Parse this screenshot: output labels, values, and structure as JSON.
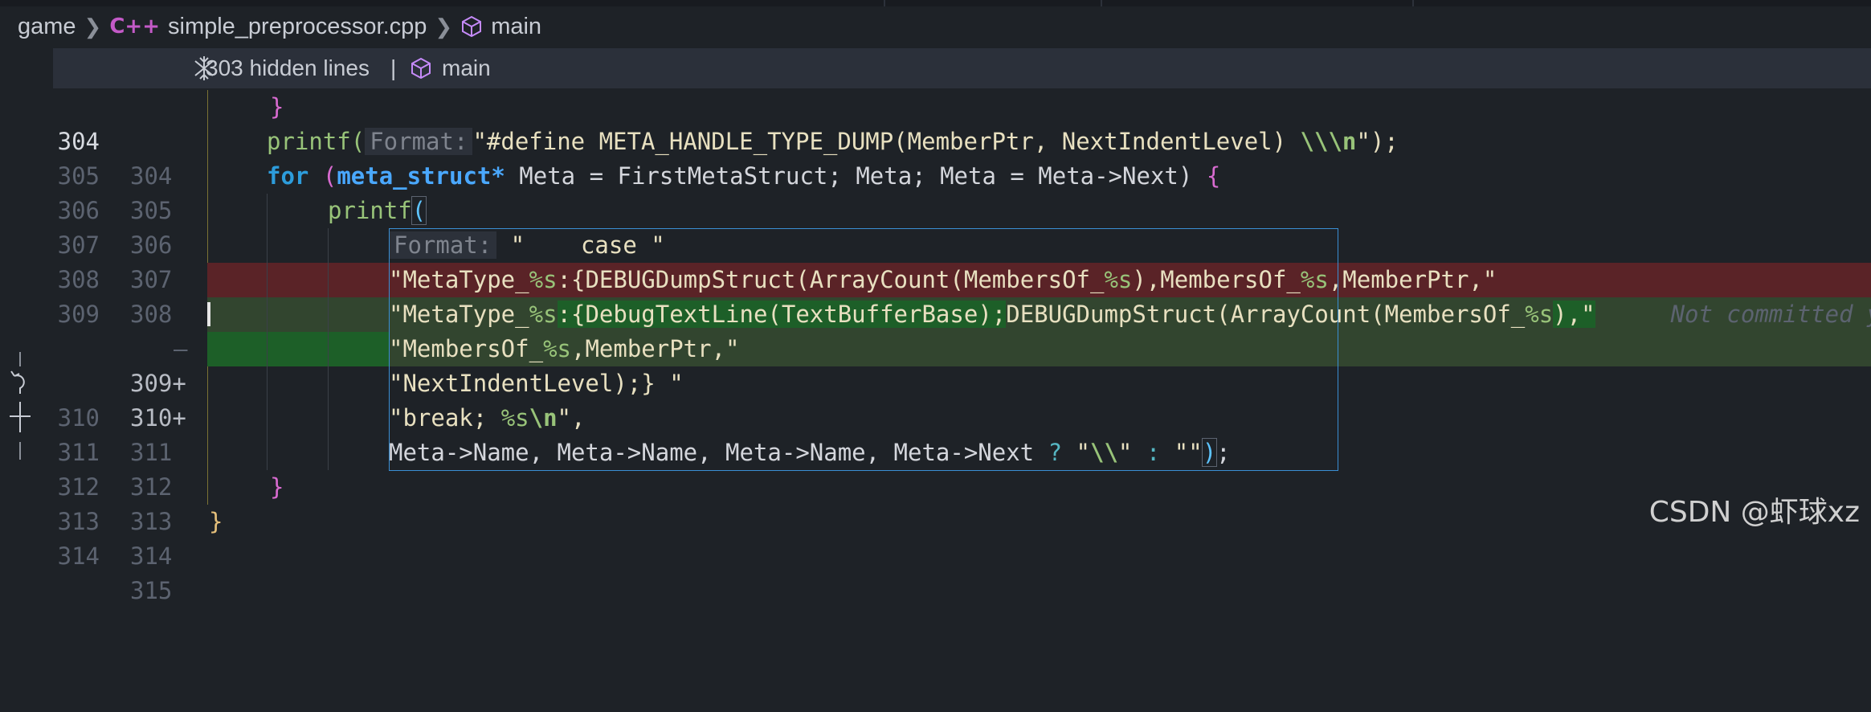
{
  "breadcrumb": {
    "folder": "game",
    "file_icon": "C++",
    "file": "simple_preprocessor.cpp",
    "symbol": "main"
  },
  "sticky": {
    "hidden_lines": "303 hidden lines",
    "pipe": "|",
    "symbol": "main"
  },
  "lines": [
    {
      "left": "304",
      "right": "304"
    },
    {
      "left": "305",
      "right": "305"
    },
    {
      "left": "306",
      "right": "306"
    },
    {
      "left": "307",
      "right": "307"
    },
    {
      "left": "308",
      "right": "308"
    },
    {
      "left": "309",
      "right": "—"
    },
    {
      "left": "",
      "right": "309+"
    },
    {
      "left": "",
      "right": "310+"
    },
    {
      "left": "310",
      "right": "311"
    },
    {
      "left": "311",
      "right": "312"
    },
    {
      "left": "312",
      "right": "313"
    },
    {
      "left": "313",
      "right": "314"
    },
    {
      "left": "314",
      "right": "315"
    }
  ],
  "code": {
    "l304_brace": "}",
    "l305_fn": "printf(",
    "l305_hint": "Format:",
    "l305_str1": "\"#define META_HANDLE_TYPE_DUMP(MemberPtr, NextIndentLevel) ",
    "l305_esc": "\\\\\\n",
    "l305_end": "\");",
    "l306_for": "for",
    "l306_paren": " (",
    "l306_type": "meta_struct*",
    "l306_rest": " Meta = FirstMetaStruct; Meta; Meta = Meta->Next) ",
    "l306_brace": "{",
    "l307_fn": "printf",
    "l307_paren": "(",
    "l308_hint": "Format:",
    "l308_str": " \"    case \"",
    "l309del_a": "\"MetaType_",
    "l309del_fmt1": "%s",
    "l309del_b": ":{DEBUGDumpStruct(ArrayCount(MembersOf_",
    "l309del_fmt2": "%s",
    "l309del_c": "),MembersOf_",
    "l309del_fmt3": "%s",
    "l309del_d": ",MemberPtr,\"",
    "l309add_a": "\"MetaType_",
    "l309add_fmt1": "%s",
    "l309add_b": ":{DebugTextLine(TextBufferBase);",
    "l309add_c": "DEBUGDumpStruct(ArrayCount(MembersOf_",
    "l309add_fmt2": "%s",
    "l309add_d": "),\"",
    "l309add_blame": "Not committed yet",
    "l310add_a": "\"MembersOf_",
    "l310add_fmt": "%s",
    "l310add_b": ",MemberPtr,\"",
    "l311_str": "\"NextIndentLevel);} \"",
    "l312_a": "\"break; ",
    "l312_fmt": "%s",
    "l312_esc": "\\n",
    "l312_b": "\",",
    "l313_a": "Meta->Name, Meta->Name, Meta->Name, Meta->Next ",
    "l313_q": "?",
    "l313_s1": " \"",
    "l313_esc": "\\\\",
    "l313_s2": "\" ",
    "l313_colon": ":",
    "l313_s3": " \"\"",
    "l313_paren": ")",
    "l313_end": ";",
    "l314_brace": "}",
    "l315_brace": "}"
  },
  "watermark": "CSDN @虾球xz",
  "colors": {
    "background": "#1e2227",
    "deleted_line": "#5a2327",
    "added_line": "#32452f",
    "added_line_strong": "#1d5f28",
    "selection_box": "#3a8fd4"
  }
}
